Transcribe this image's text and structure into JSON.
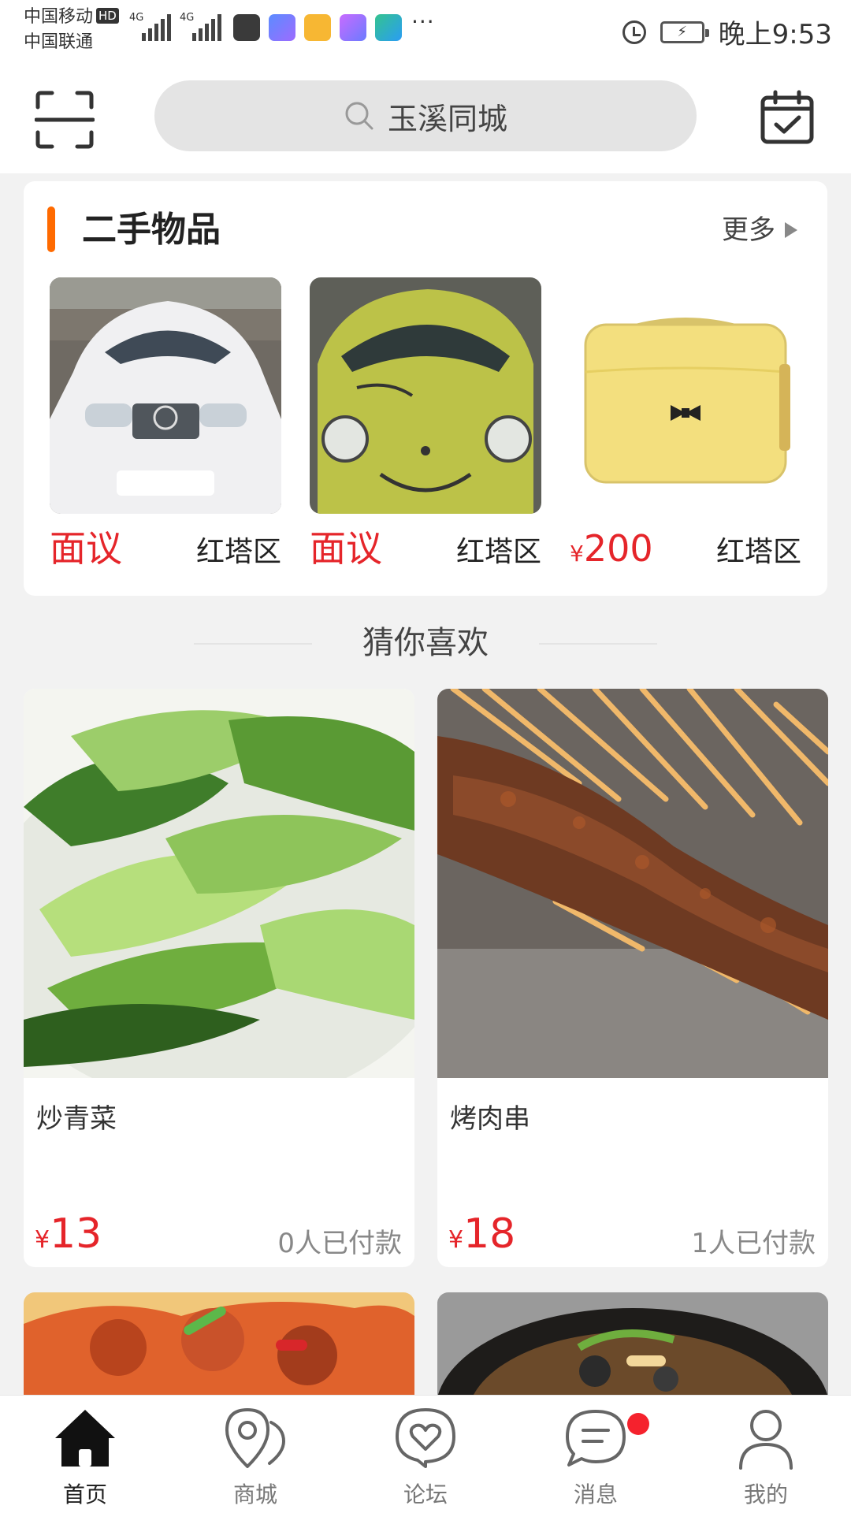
{
  "status_bar": {
    "carrier_1": "中国移动",
    "carrier_1_badge": "HD",
    "carrier_2": "中国联通",
    "network_1": "4G",
    "network_2": "4G",
    "more": "···",
    "time": "晚上9:53",
    "icons": [
      "alarm-icon",
      "battery-icon"
    ],
    "app_icons": [
      "huawei-icon",
      "app-blue-icon",
      "mail-icon",
      "video-icon",
      "game-icon"
    ]
  },
  "header": {
    "search_placeholder": "玉溪同城",
    "left_icon": "scan-icon",
    "right_icon": "calendar-check-icon"
  },
  "second_hand": {
    "title": "二手物品",
    "more_label": "更多",
    "items": [
      {
        "price": "面议",
        "location": "红塔区",
        "image": "white-car"
      },
      {
        "price": "面议",
        "location": "红塔区",
        "image": "green-car"
      },
      {
        "price": "200",
        "currency": "¥",
        "location": "红塔区",
        "image": "yellow-handbag"
      }
    ]
  },
  "guess": {
    "title": "猜你喜欢",
    "products": [
      {
        "name": "炒青菜",
        "price": "13",
        "currency": "¥",
        "paid": "0人已付款",
        "image": "stir-fried-greens"
      },
      {
        "name": "烤肉串",
        "price": "18",
        "currency": "¥",
        "paid": "1人已付款",
        "image": "grilled-skewers"
      }
    ],
    "partial_images": [
      "spicy-chicken",
      "clay-pot-dish"
    ]
  },
  "tabbar": {
    "tabs": [
      {
        "label": "首页",
        "icon": "home-icon",
        "active": true
      },
      {
        "label": "商城",
        "icon": "map-pin-icon",
        "active": false
      },
      {
        "label": "论坛",
        "icon": "heart-chat-icon",
        "active": false
      },
      {
        "label": "消息",
        "icon": "message-icon",
        "active": false,
        "badge": true
      },
      {
        "label": "我的",
        "icon": "user-icon",
        "active": false
      }
    ]
  },
  "colors": {
    "accent": "#ff6a00",
    "price": "#e5252a",
    "badge": "#f5222d"
  }
}
